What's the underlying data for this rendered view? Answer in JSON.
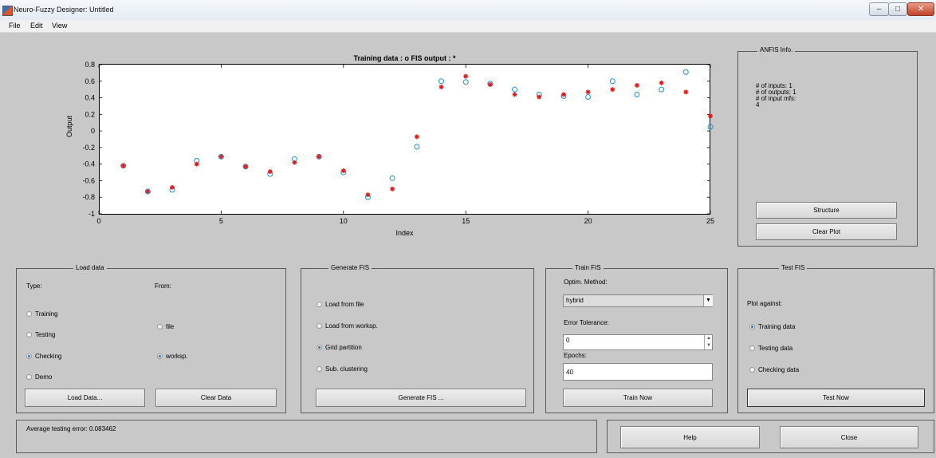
{
  "window": {
    "title": "Neuro-Fuzzy Designer: Untitled"
  },
  "menu": {
    "items": [
      "File",
      "Edit",
      "View"
    ]
  },
  "plot": {
    "title": "Training data : o   FIS output : *",
    "xlabel": "Index",
    "ylabel": "Output"
  },
  "chart_data": {
    "type": "scatter",
    "title": "Training data : o   FIS output : *",
    "xlabel": "Index",
    "ylabel": "Output",
    "xlim": [
      0,
      25
    ],
    "ylim": [
      -1,
      0.8
    ],
    "xticks": [
      "0",
      "5",
      "10",
      "15",
      "20",
      "25"
    ],
    "yticks": [
      "-1",
      "-0.8",
      "-0.6",
      "-0.4",
      "-0.2",
      "0",
      "0.2",
      "0.4",
      "0.6",
      "0.8"
    ],
    "grid": false,
    "series": [
      {
        "marker": "o",
        "color": "#1f8fd8",
        "x": [
          1,
          2,
          3,
          4,
          5,
          6,
          7,
          8,
          9,
          10,
          11,
          12,
          13,
          14,
          15,
          16,
          17,
          18,
          19,
          20,
          21,
          22,
          23,
          24,
          25
        ],
        "y": [
          -0.42,
          -0.73,
          -0.71,
          -0.36,
          -0.31,
          -0.43,
          -0.52,
          -0.34,
          -0.31,
          -0.5,
          -0.8,
          -0.57,
          -0.19,
          0.6,
          0.59,
          0.57,
          0.5,
          0.44,
          0.42,
          0.41,
          0.6,
          0.44,
          0.5,
          0.71,
          0.05
        ]
      },
      {
        "marker": "*",
        "color": "#e01b1b",
        "x": [
          1,
          2,
          3,
          4,
          5,
          6,
          7,
          8,
          9,
          10,
          11,
          12,
          13,
          14,
          15,
          16,
          17,
          18,
          19,
          20,
          21,
          22,
          23,
          24,
          25
        ],
        "y": [
          -0.42,
          -0.73,
          -0.68,
          -0.4,
          -0.31,
          -0.43,
          -0.49,
          -0.38,
          -0.31,
          -0.48,
          -0.77,
          -0.7,
          -0.07,
          0.53,
          0.66,
          0.56,
          0.44,
          0.41,
          0.44,
          0.47,
          0.5,
          0.55,
          0.58,
          0.47,
          0.18
        ]
      }
    ]
  },
  "anfis_info": {
    "title": "ANFIS Info.",
    "lines": [
      "# of inputs: 1",
      "# of outputs: 1",
      "# of input mfs:",
      "4"
    ],
    "structure_button": "Structure",
    "clear_plot_button": "Clear Plot"
  },
  "load_data": {
    "title": "Load data",
    "type_label": "Type:",
    "from_label": "From:",
    "types": [
      {
        "label": "Training",
        "selected": false
      },
      {
        "label": "Testing",
        "selected": false
      },
      {
        "label": "Checking",
        "selected": true
      },
      {
        "label": "Demo",
        "selected": false
      }
    ],
    "sources": [
      {
        "label": "file",
        "selected": false
      },
      {
        "label": "worksp.",
        "selected": true
      }
    ],
    "load_button": "Load Data...",
    "clear_button": "Clear Data"
  },
  "generate_fis": {
    "title": "Generate FIS",
    "options": [
      {
        "label": "Load from file",
        "selected": false
      },
      {
        "label": "Load from worksp.",
        "selected": false
      },
      {
        "label": "Grid partition",
        "selected": true
      },
      {
        "label": "Sub. clustering",
        "selected": false
      }
    ],
    "button": "Generate FIS ..."
  },
  "train_fis": {
    "title": "Train FIS",
    "method_label": "Optim. Method:",
    "method_value": "hybrid",
    "error_label": "Error Tolerance:",
    "error_value": "0",
    "epochs_label": "Epochs:",
    "epochs_value": "40",
    "button": "Train Now"
  },
  "test_fis": {
    "title": "Test FIS",
    "plot_against_label": "Plot against:",
    "options": [
      {
        "label": "Training data",
        "selected": true
      },
      {
        "label": "Testing data",
        "selected": false
      },
      {
        "label": "Checking data",
        "selected": false
      }
    ],
    "button": "Test Now"
  },
  "status": {
    "text": "Average testing error: 0.083462"
  },
  "footer": {
    "help_button": "Help",
    "close_button": "Close"
  }
}
